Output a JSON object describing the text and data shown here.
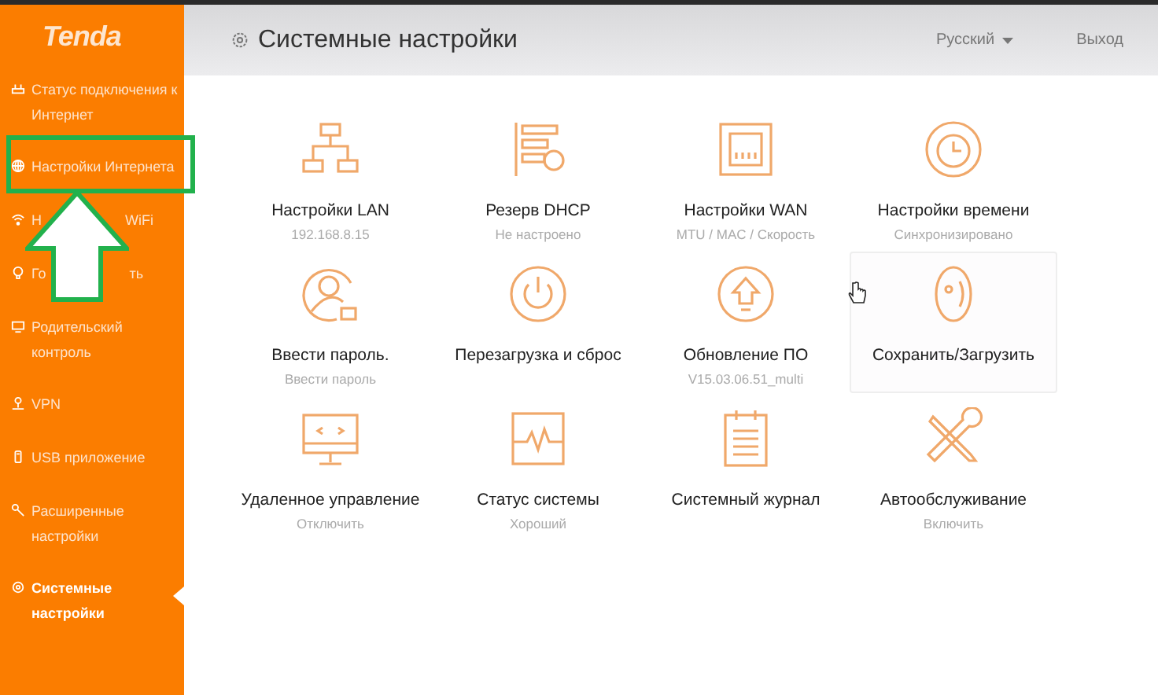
{
  "sidebar": {
    "logo": "Tenda",
    "items": [
      {
        "label": "Статус подключения к Интернет",
        "selected": false
      },
      {
        "label": "Настройки Интернета",
        "selected": false
      },
      {
        "label_parts": [
          "Н",
          "WiFi"
        ],
        "selected": false
      },
      {
        "label_parts": [
          "Го",
          "ть"
        ],
        "selected": false
      },
      {
        "label": "Родительский контроль",
        "selected": false
      },
      {
        "label": "VPN",
        "selected": false
      },
      {
        "label": "USB приложение",
        "selected": false
      },
      {
        "label": "Расширенные настройки",
        "selected": false
      },
      {
        "label": "Системные настройки",
        "selected": true
      }
    ]
  },
  "header": {
    "title": "Системные настройки",
    "language": "Русский",
    "logout": "Выход"
  },
  "tiles": [
    {
      "title": "Настройки LAN",
      "subtitle": "192.168.8.15",
      "highlighted": false
    },
    {
      "title": "Резерв DHCP",
      "subtitle": "Не настроено",
      "highlighted": false
    },
    {
      "title": "Настройки WAN",
      "subtitle": "MTU / MAC / Скорость",
      "highlighted": false
    },
    {
      "title": "Настройки времени",
      "subtitle": "Синхронизировано",
      "highlighted": false
    },
    {
      "title": "Ввести пароль.",
      "subtitle": "Ввести пароль",
      "highlighted": false
    },
    {
      "title": "Перезагрузка и сброс",
      "highlighted": false
    },
    {
      "title": "Обновление ПО",
      "subtitle": "V15.03.06.51_multi",
      "highlighted": false
    },
    {
      "title": "Сохранить/Загрузить",
      "highlighted": true
    },
    {
      "title": "Удаленное управление",
      "subtitle": "Отключить",
      "highlighted": false
    },
    {
      "title": "Статус системы",
      "subtitle": "Хороший",
      "highlighted": false
    },
    {
      "title": "Системный журнал",
      "highlighted": false
    },
    {
      "title": "Автообслуживание",
      "subtitle": "Включить",
      "highlighted": false
    }
  ]
}
